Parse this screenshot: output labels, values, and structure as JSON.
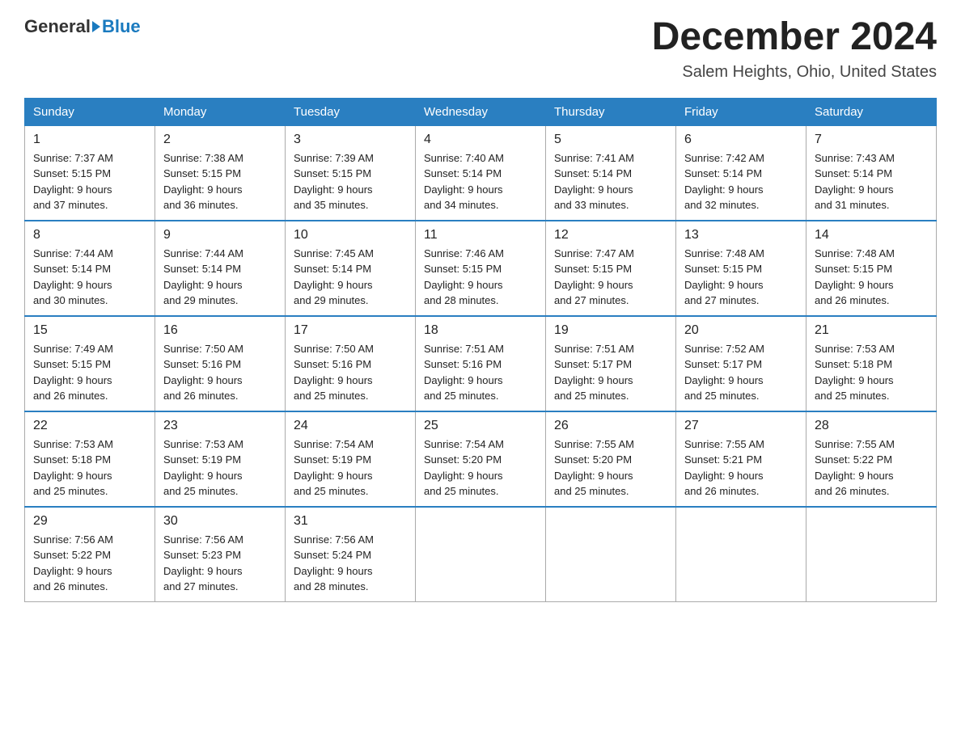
{
  "header": {
    "logo": {
      "general": "General",
      "blue": "Blue"
    },
    "title": "December 2024",
    "location": "Salem Heights, Ohio, United States"
  },
  "days_of_week": [
    "Sunday",
    "Monday",
    "Tuesday",
    "Wednesday",
    "Thursday",
    "Friday",
    "Saturday"
  ],
  "weeks": [
    [
      {
        "day": "1",
        "sunrise": "7:37 AM",
        "sunset": "5:15 PM",
        "daylight": "9 hours and 37 minutes."
      },
      {
        "day": "2",
        "sunrise": "7:38 AM",
        "sunset": "5:15 PM",
        "daylight": "9 hours and 36 minutes."
      },
      {
        "day": "3",
        "sunrise": "7:39 AM",
        "sunset": "5:15 PM",
        "daylight": "9 hours and 35 minutes."
      },
      {
        "day": "4",
        "sunrise": "7:40 AM",
        "sunset": "5:14 PM",
        "daylight": "9 hours and 34 minutes."
      },
      {
        "day": "5",
        "sunrise": "7:41 AM",
        "sunset": "5:14 PM",
        "daylight": "9 hours and 33 minutes."
      },
      {
        "day": "6",
        "sunrise": "7:42 AM",
        "sunset": "5:14 PM",
        "daylight": "9 hours and 32 minutes."
      },
      {
        "day": "7",
        "sunrise": "7:43 AM",
        "sunset": "5:14 PM",
        "daylight": "9 hours and 31 minutes."
      }
    ],
    [
      {
        "day": "8",
        "sunrise": "7:44 AM",
        "sunset": "5:14 PM",
        "daylight": "9 hours and 30 minutes."
      },
      {
        "day": "9",
        "sunrise": "7:44 AM",
        "sunset": "5:14 PM",
        "daylight": "9 hours and 29 minutes."
      },
      {
        "day": "10",
        "sunrise": "7:45 AM",
        "sunset": "5:14 PM",
        "daylight": "9 hours and 29 minutes."
      },
      {
        "day": "11",
        "sunrise": "7:46 AM",
        "sunset": "5:15 PM",
        "daylight": "9 hours and 28 minutes."
      },
      {
        "day": "12",
        "sunrise": "7:47 AM",
        "sunset": "5:15 PM",
        "daylight": "9 hours and 27 minutes."
      },
      {
        "day": "13",
        "sunrise": "7:48 AM",
        "sunset": "5:15 PM",
        "daylight": "9 hours and 27 minutes."
      },
      {
        "day": "14",
        "sunrise": "7:48 AM",
        "sunset": "5:15 PM",
        "daylight": "9 hours and 26 minutes."
      }
    ],
    [
      {
        "day": "15",
        "sunrise": "7:49 AM",
        "sunset": "5:15 PM",
        "daylight": "9 hours and 26 minutes."
      },
      {
        "day": "16",
        "sunrise": "7:50 AM",
        "sunset": "5:16 PM",
        "daylight": "9 hours and 26 minutes."
      },
      {
        "day": "17",
        "sunrise": "7:50 AM",
        "sunset": "5:16 PM",
        "daylight": "9 hours and 25 minutes."
      },
      {
        "day": "18",
        "sunrise": "7:51 AM",
        "sunset": "5:16 PM",
        "daylight": "9 hours and 25 minutes."
      },
      {
        "day": "19",
        "sunrise": "7:51 AM",
        "sunset": "5:17 PM",
        "daylight": "9 hours and 25 minutes."
      },
      {
        "day": "20",
        "sunrise": "7:52 AM",
        "sunset": "5:17 PM",
        "daylight": "9 hours and 25 minutes."
      },
      {
        "day": "21",
        "sunrise": "7:53 AM",
        "sunset": "5:18 PM",
        "daylight": "9 hours and 25 minutes."
      }
    ],
    [
      {
        "day": "22",
        "sunrise": "7:53 AM",
        "sunset": "5:18 PM",
        "daylight": "9 hours and 25 minutes."
      },
      {
        "day": "23",
        "sunrise": "7:53 AM",
        "sunset": "5:19 PM",
        "daylight": "9 hours and 25 minutes."
      },
      {
        "day": "24",
        "sunrise": "7:54 AM",
        "sunset": "5:19 PM",
        "daylight": "9 hours and 25 minutes."
      },
      {
        "day": "25",
        "sunrise": "7:54 AM",
        "sunset": "5:20 PM",
        "daylight": "9 hours and 25 minutes."
      },
      {
        "day": "26",
        "sunrise": "7:55 AM",
        "sunset": "5:20 PM",
        "daylight": "9 hours and 25 minutes."
      },
      {
        "day": "27",
        "sunrise": "7:55 AM",
        "sunset": "5:21 PM",
        "daylight": "9 hours and 26 minutes."
      },
      {
        "day": "28",
        "sunrise": "7:55 AM",
        "sunset": "5:22 PM",
        "daylight": "9 hours and 26 minutes."
      }
    ],
    [
      {
        "day": "29",
        "sunrise": "7:56 AM",
        "sunset": "5:22 PM",
        "daylight": "9 hours and 26 minutes."
      },
      {
        "day": "30",
        "sunrise": "7:56 AM",
        "sunset": "5:23 PM",
        "daylight": "9 hours and 27 minutes."
      },
      {
        "day": "31",
        "sunrise": "7:56 AM",
        "sunset": "5:24 PM",
        "daylight": "9 hours and 28 minutes."
      },
      null,
      null,
      null,
      null
    ]
  ],
  "labels": {
    "sunrise": "Sunrise:",
    "sunset": "Sunset:",
    "daylight": "Daylight:"
  }
}
